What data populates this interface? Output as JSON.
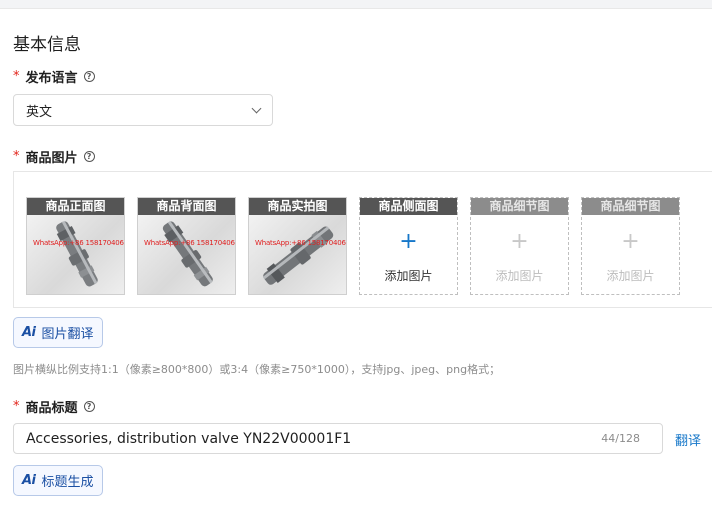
{
  "section": {
    "title": "基本信息"
  },
  "language": {
    "label": "发布语言",
    "required_mark": "*",
    "help": "?",
    "selected": "英文"
  },
  "images": {
    "label": "商品图片",
    "required_mark": "*",
    "help": "?",
    "cards": [
      {
        "title": "商品正面图",
        "watermark": "WhatsApp:+86 15817040688",
        "filled": true
      },
      {
        "title": "商品背面图",
        "watermark": "WhatsApp:+86 15817040688",
        "filled": true
      },
      {
        "title": "商品实拍图",
        "watermark": "WhatsApp:+86 15817040688",
        "filled": true
      },
      {
        "title": "商品侧面图",
        "add_label": "添加图片",
        "plus": "+",
        "enabled": true
      },
      {
        "title": "商品细节图",
        "add_label": "添加图片",
        "plus": "+",
        "enabled": false
      },
      {
        "title": "商品细节图",
        "add_label": "添加图片",
        "plus": "+",
        "enabled": false
      }
    ],
    "translate_button": {
      "badge": "Ai",
      "label": "图片翻译"
    },
    "hint": "图片横纵比例支持1:1（像素≥800*800）或3:4（像素≥750*1000），支持jpg、jpeg、png格式；"
  },
  "product_title": {
    "label": "商品标题",
    "required_mark": "*",
    "help": "?",
    "value": "Accessories, distribution valve YN22V00001F1",
    "char_count": "44/128",
    "translate_link": "翻译",
    "generate_button": {
      "badge": "Ai",
      "label": "标题生成"
    }
  },
  "colors": {
    "accent_blue": "#1677c9",
    "required_red": "#e2231a",
    "card_header": "#555555",
    "watermark_red": "#e02020"
  }
}
